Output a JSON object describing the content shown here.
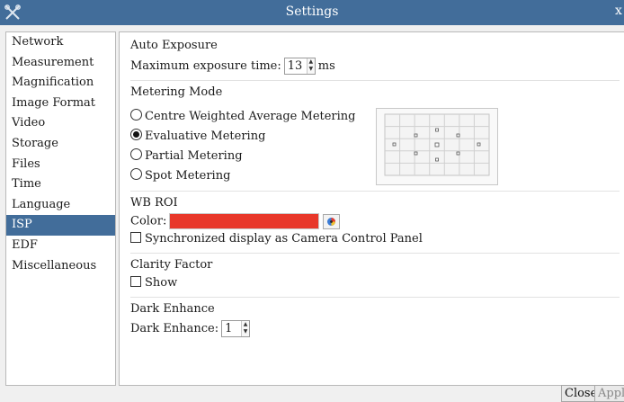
{
  "window": {
    "title": "Settings",
    "close_glyph": "x"
  },
  "sidebar": {
    "items": [
      {
        "label": "Network",
        "selected": false
      },
      {
        "label": "Measurement",
        "selected": false
      },
      {
        "label": "Magnification",
        "selected": false
      },
      {
        "label": "Image Format",
        "selected": false
      },
      {
        "label": "Video",
        "selected": false
      },
      {
        "label": "Storage",
        "selected": false
      },
      {
        "label": "Files",
        "selected": false
      },
      {
        "label": "Time",
        "selected": false
      },
      {
        "label": "Language",
        "selected": false
      },
      {
        "label": "ISP",
        "selected": true
      },
      {
        "label": "EDF",
        "selected": false
      },
      {
        "label": "Miscellaneous",
        "selected": false
      }
    ]
  },
  "auto_exposure": {
    "title": "Auto Exposure",
    "max_time_label": "Maximum exposure time:",
    "max_time_value": "13",
    "unit": "ms"
  },
  "metering_mode": {
    "title": "Metering Mode",
    "options": [
      {
        "label": "Centre Weighted Average Metering",
        "checked": false
      },
      {
        "label": "Evaluative Metering",
        "checked": true
      },
      {
        "label": "Partial Metering",
        "checked": false
      },
      {
        "label": "Spot Metering",
        "checked": false
      }
    ]
  },
  "wb_roi": {
    "title": "WB ROI",
    "color_label": "Color:",
    "color": "#e8372a",
    "sync_label": "Synchronized display as Camera Control Panel",
    "sync_checked": false
  },
  "clarity": {
    "title": "Clarity Factor",
    "show_label": "Show",
    "show_checked": false
  },
  "dark_enhance": {
    "title": "Dark Enhance",
    "label": "Dark Enhance:",
    "value": "1"
  },
  "buttons": {
    "close": "Close",
    "apply": "Apply"
  },
  "colors": {
    "accent": "#426d9a"
  }
}
